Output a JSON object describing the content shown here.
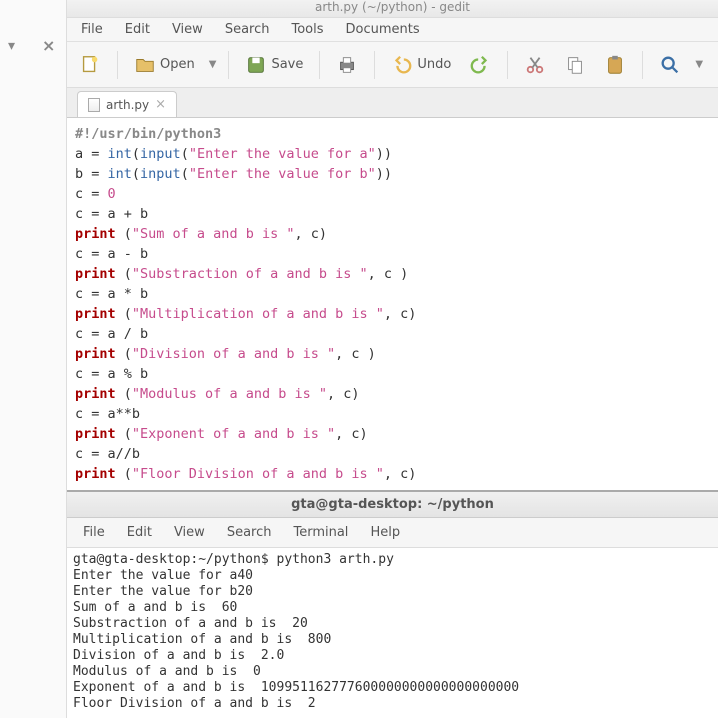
{
  "title_partial": "arth.py (~/python) - gedit",
  "gedit_menu": [
    "File",
    "Edit",
    "View",
    "Search",
    "Tools",
    "Documents"
  ],
  "toolbar": {
    "open": "Open",
    "save": "Save",
    "undo": "Undo"
  },
  "tab": {
    "name": "arth.py"
  },
  "code": {
    "shebang": "#!/usr/bin/python3",
    "l2a": "a = ",
    "l2b": "int",
    "l2c": "(",
    "l2d": "input",
    "l2e": "(",
    "l2f": "\"Enter the value for a\"",
    "l2g": "))",
    "l3a": "b = ",
    "l3b": "int",
    "l3c": "(",
    "l3d": "input",
    "l3e": "(",
    "l3f": "\"Enter the value for b\"",
    "l3g": "))",
    "l4": "c = ",
    "l4n": "0",
    "l5": "c = a + b",
    "p": "print",
    "l6": " (",
    "l6s": "\"Sum of a and b is \"",
    "l6e": ", c)",
    "l7": "c = a - b",
    "l8": " (",
    "l8s": "\"Substraction of a and b is \"",
    "l8e": ", c )",
    "l9": "c = a * b",
    "l10": " (",
    "l10s": "\"Multiplication of a and b is \"",
    "l10e": ", c)",
    "l11": "c = a / b",
    "l12": " (",
    "l12s": "\"Division of a and b is \"",
    "l12e": ", c )",
    "l13": "c = a % b",
    "l14": " (",
    "l14s": "\"Modulus of a and b is \"",
    "l14e": ", c)",
    "l15": "c = a**b",
    "l16": " (",
    "l16s": "\"Exponent of a and b is \"",
    "l16e": ", c)",
    "l17": "c = a//b",
    "l18": " (",
    "l18s": "\"Floor Division of a and b is \"",
    "l18e": ", c)"
  },
  "terminal": {
    "title": "gta@gta-desktop: ~/python",
    "menu": [
      "File",
      "Edit",
      "View",
      "Search",
      "Terminal",
      "Help"
    ],
    "lines": [
      "gta@gta-desktop:~/python$ python3 arth.py",
      "Enter the value for a40",
      "Enter the value for b20",
      "Sum of a and b is  60",
      "Substraction of a and b is  20",
      "Multiplication of a and b is  800",
      "Division of a and b is  2.0",
      "Modulus of a and b is  0",
      "Exponent of a and b is  109951162777600000000000000000000",
      "Floor Division of a and b is  2"
    ]
  }
}
